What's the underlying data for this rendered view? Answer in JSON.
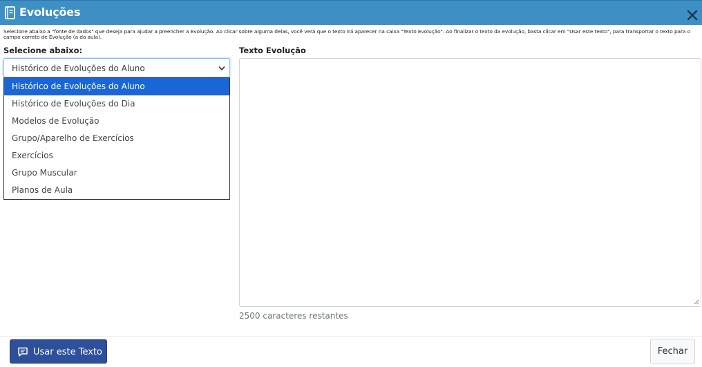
{
  "modal": {
    "title": "Evoluções",
    "close_icon": "close-icon",
    "title_icon": "book-icon"
  },
  "instructions": "Selecione abaixo a \"fonte de dados\" que deseja para ajudar a preencher a Evolução. Ao clicar sobre alguma delas, você verá que o texto irá aparecer na caixa \"Texto Evolução\". Ao finalizar o texto da evolução, basta clicar em \"Usar este texto\", para transportar o texto para o campo correto de Evolução (a da aula).",
  "source": {
    "label": "Selecione abaixo:",
    "selected": "Histórico de Evoluções do Aluno",
    "options": [
      "Histórico de Evoluções do Aluno",
      "Histórico de Evoluções do Dia",
      "Modelos de Evolução",
      "Grupo/Aparelho de Exercícios",
      "Exercícios",
      "Grupo Muscular",
      "Planos de Aula"
    ]
  },
  "text": {
    "label": "Texto Evolução",
    "value": "",
    "remaining": "2500 caracteres restantes"
  },
  "footer": {
    "use_label": "Usar este Texto",
    "close_label": "Fechar"
  },
  "colors": {
    "header": "#3d8fc4",
    "primary": "#2e4f9a",
    "selection": "#1a66d6"
  }
}
